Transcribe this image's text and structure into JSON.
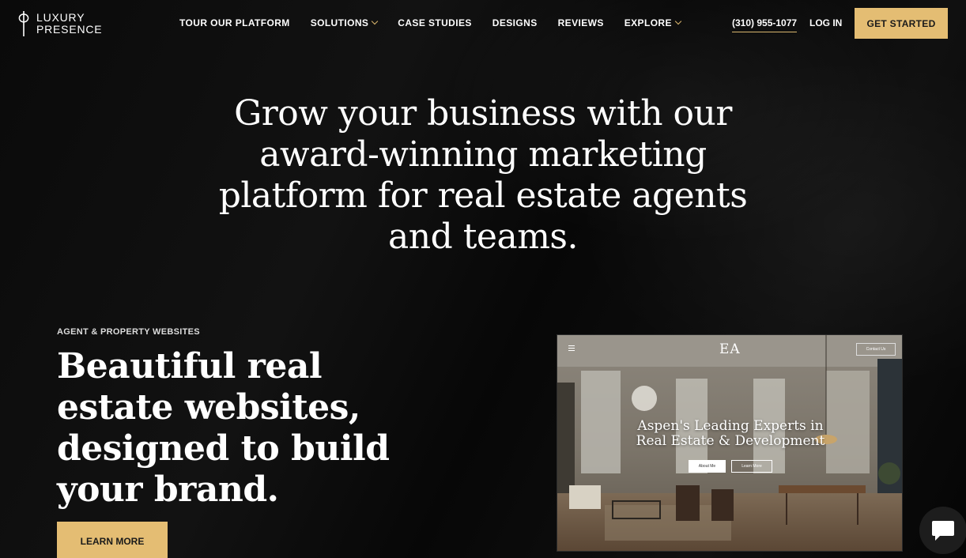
{
  "brand": {
    "line1": "LUXURY",
    "line2": "PRESENCE"
  },
  "nav": {
    "items": [
      {
        "label": "TOUR OUR PLATFORM",
        "dropdown": false
      },
      {
        "label": "SOLUTIONS",
        "dropdown": true
      },
      {
        "label": "CASE STUDIES",
        "dropdown": false
      },
      {
        "label": "DESIGNS",
        "dropdown": false
      },
      {
        "label": "REVIEWS",
        "dropdown": false
      },
      {
        "label": "EXPLORE",
        "dropdown": true
      }
    ],
    "phone": "(310) 955-1077",
    "login": "LOG IN",
    "cta": "GET STARTED"
  },
  "hero": {
    "title": "Grow your business with our award-winning marketing platform for real estate agents and teams."
  },
  "section": {
    "eyebrow": "AGENT & PROPERTY WEBSITES",
    "title": "Beautiful real estate websites, designed to build your brand.",
    "button": "LEARN MORE"
  },
  "preview": {
    "logo": "EA",
    "contact": "Contact Us",
    "headline": "Aspen's Leading Experts in Real Estate & Development",
    "button_primary": "About Me",
    "button_secondary": "Learn More"
  },
  "colors": {
    "accent": "#e4bd73",
    "background": "#060606"
  },
  "icons": {
    "chat": "chat-bubble-icon",
    "menu": "hamburger-icon"
  }
}
